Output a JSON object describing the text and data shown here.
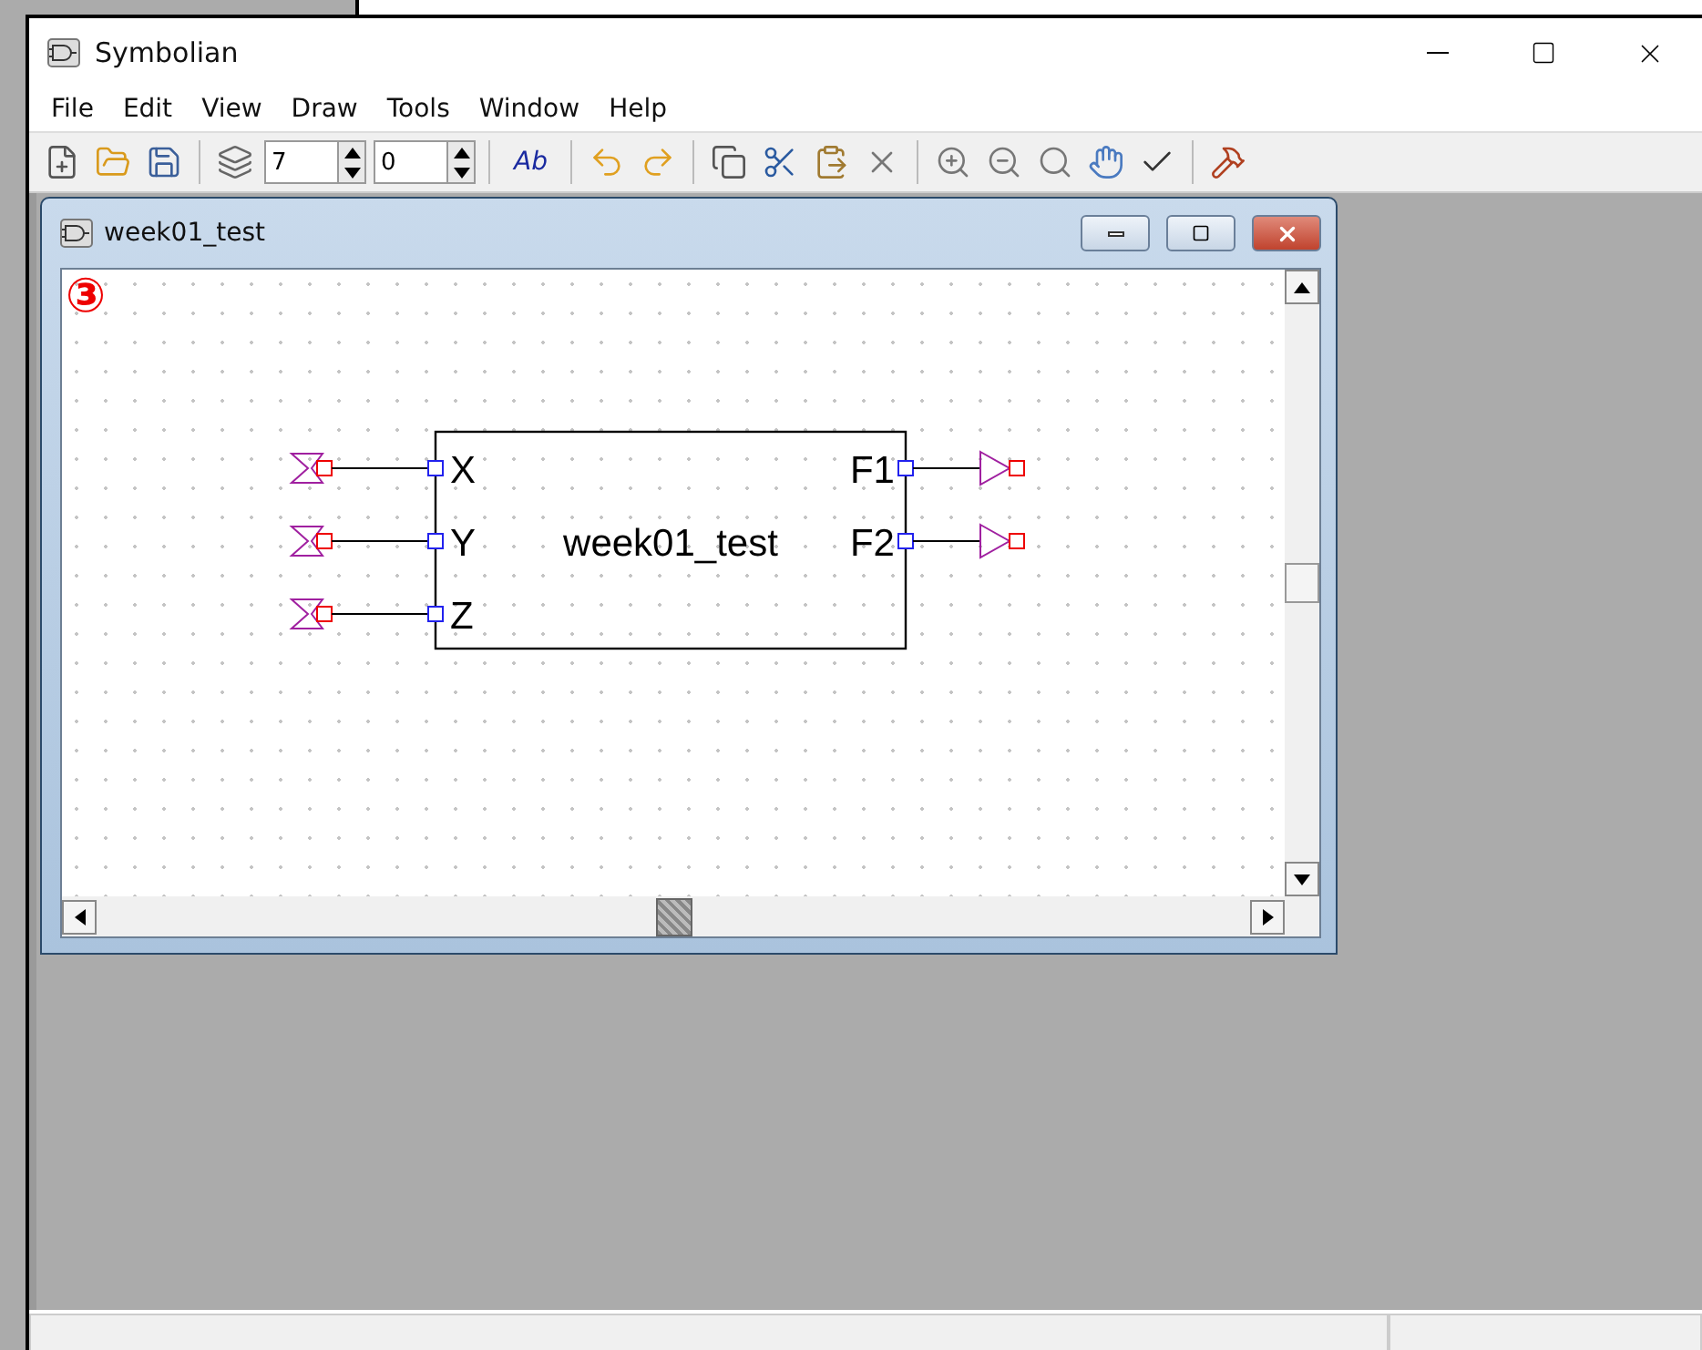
{
  "window": {
    "title": "Symbolian"
  },
  "menu": [
    "File",
    "Edit",
    "View",
    "Draw",
    "Tools",
    "Window",
    "Help"
  ],
  "toolbar": {
    "spinners": [
      "7",
      "0"
    ],
    "text_button": "Ab"
  },
  "document": {
    "title": "week01_test",
    "annotation": "③",
    "symbol": {
      "name": "week01_test",
      "inputs": [
        "X",
        "Y",
        "Z"
      ],
      "outputs": [
        "F1",
        "F2"
      ]
    }
  }
}
